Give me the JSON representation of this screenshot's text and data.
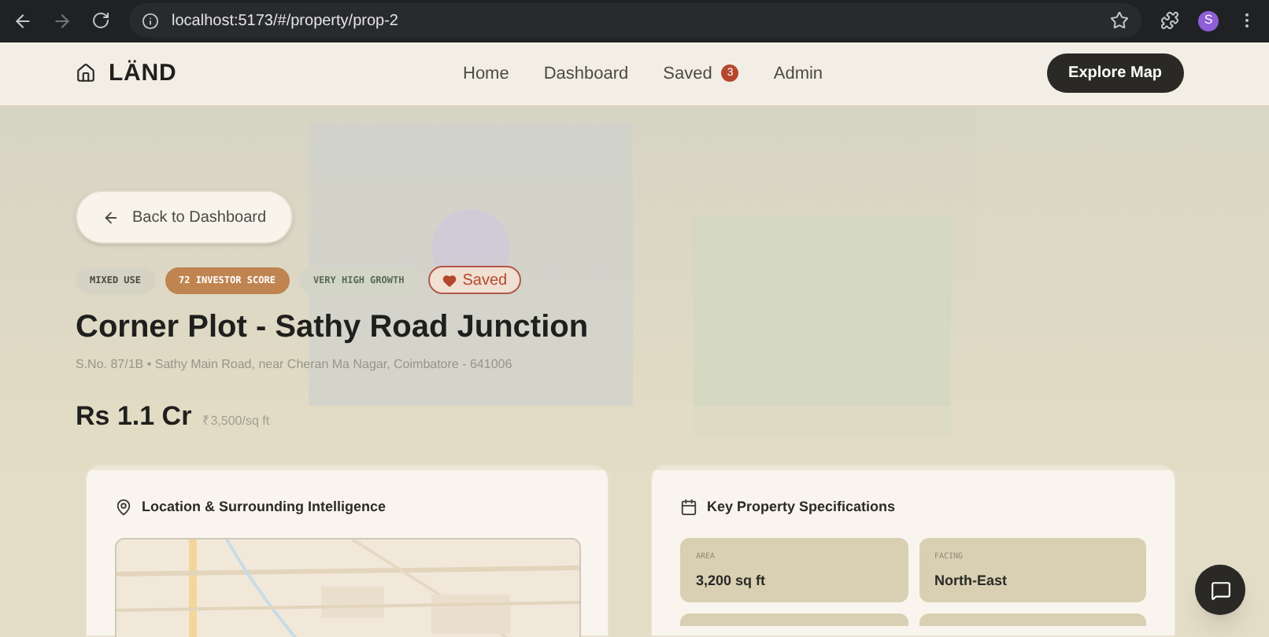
{
  "browser": {
    "url": "localhost:5173/#/property/prop-2",
    "profile_initial": "S"
  },
  "nav": {
    "brand": "LÄND",
    "links": [
      {
        "label": "Home"
      },
      {
        "label": "Dashboard"
      },
      {
        "label": "Saved",
        "badge": "3"
      },
      {
        "label": "Admin"
      }
    ],
    "cta": "Explore Map"
  },
  "hero": {
    "back": "Back to Dashboard",
    "tags": [
      {
        "label": "MIXED USE",
        "kind": "neutral"
      },
      {
        "label": "72 INVESTOR SCORE",
        "kind": "score"
      },
      {
        "label": "VERY HIGH GROWTH",
        "kind": "growth"
      }
    ],
    "save": {
      "label": "Saved",
      "saved": true
    },
    "title": "Corner Plot - Sathy Road Junction",
    "address": "S.No. 87/1B • Sathy Main Road, near Cheran Ma Nagar, Coimbatore - 641006",
    "price": "Rs 1.1 Cr",
    "rate": "₹3,500/sq ft"
  },
  "location_card": {
    "title": "Location & Surrounding Intelligence"
  },
  "specs_card": {
    "title": "Key Property Specifications",
    "specs": [
      {
        "label": "AREA",
        "value": "3,200 sq ft"
      },
      {
        "label": "FACING",
        "value": "North-East"
      }
    ]
  }
}
